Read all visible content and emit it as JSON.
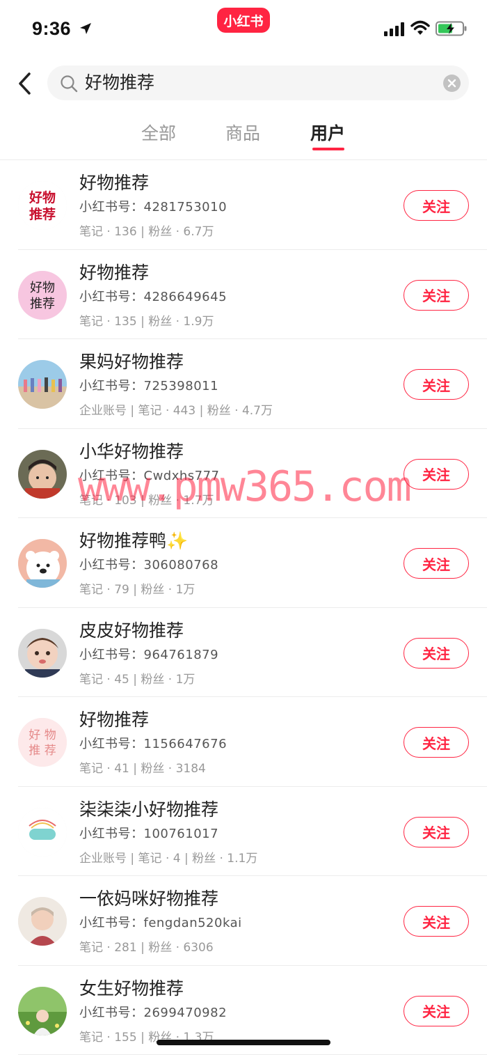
{
  "status_bar": {
    "time": "9:36",
    "app_logo": "小红书"
  },
  "search": {
    "query": "好物推荐"
  },
  "tabs": [
    {
      "label": "全部",
      "active": false
    },
    {
      "label": "商品",
      "active": false
    },
    {
      "label": "用户",
      "active": true
    }
  ],
  "follow_label": "关注",
  "users": [
    {
      "name": "好物推荐",
      "id": "小红书号：4281753010",
      "stats": "笔记 · 136 | 粉丝 · 6.7万",
      "avatar_text": "好物推荐"
    },
    {
      "name": "好物推荐",
      "id": "小红书号：4286649645",
      "stats": "笔记 · 135 | 粉丝 · 1.9万",
      "avatar_text": "好物推荐"
    },
    {
      "name": "果妈好物推荐",
      "id": "小红书号：725398011",
      "stats": "企业账号 | 笔记 · 443 | 粉丝 · 4.7万"
    },
    {
      "name": "小华好物推荐",
      "id": "小红书号：Cwdxhs777",
      "stats": "笔记 · 103 | 粉丝 · 1.7万"
    },
    {
      "name": "好物推荐鸭✨",
      "id": "小红书号：306080768",
      "stats": "笔记 · 79 | 粉丝 · 1万"
    },
    {
      "name": "皮皮好物推荐",
      "id": "小红书号：964761879",
      "stats": "笔记 · 45 | 粉丝 · 1万"
    },
    {
      "name": "好物推荐",
      "id": "小红书号：1156647676",
      "stats": "笔记 · 41 | 粉丝 · 3184",
      "avatar_text": "好物推荐"
    },
    {
      "name": "柒柒柒小好物推荐",
      "id": "小红书号：100761017",
      "stats": "企业账号 | 笔记 · 4 | 粉丝 · 1.1万"
    },
    {
      "name": "一依妈咪好物推荐",
      "id": "小红书号：fengdan520kai",
      "stats": "笔记 · 281 | 粉丝 · 6306"
    },
    {
      "name": "女生好物推荐",
      "id": "小红书号：2699470982",
      "stats": "笔记 · 155 | 粉丝 · 1.3万"
    }
  ],
  "watermark": "www.pmw365.com",
  "colors": {
    "accent": "#ff2442",
    "text": "#222222",
    "muted": "#999999"
  }
}
